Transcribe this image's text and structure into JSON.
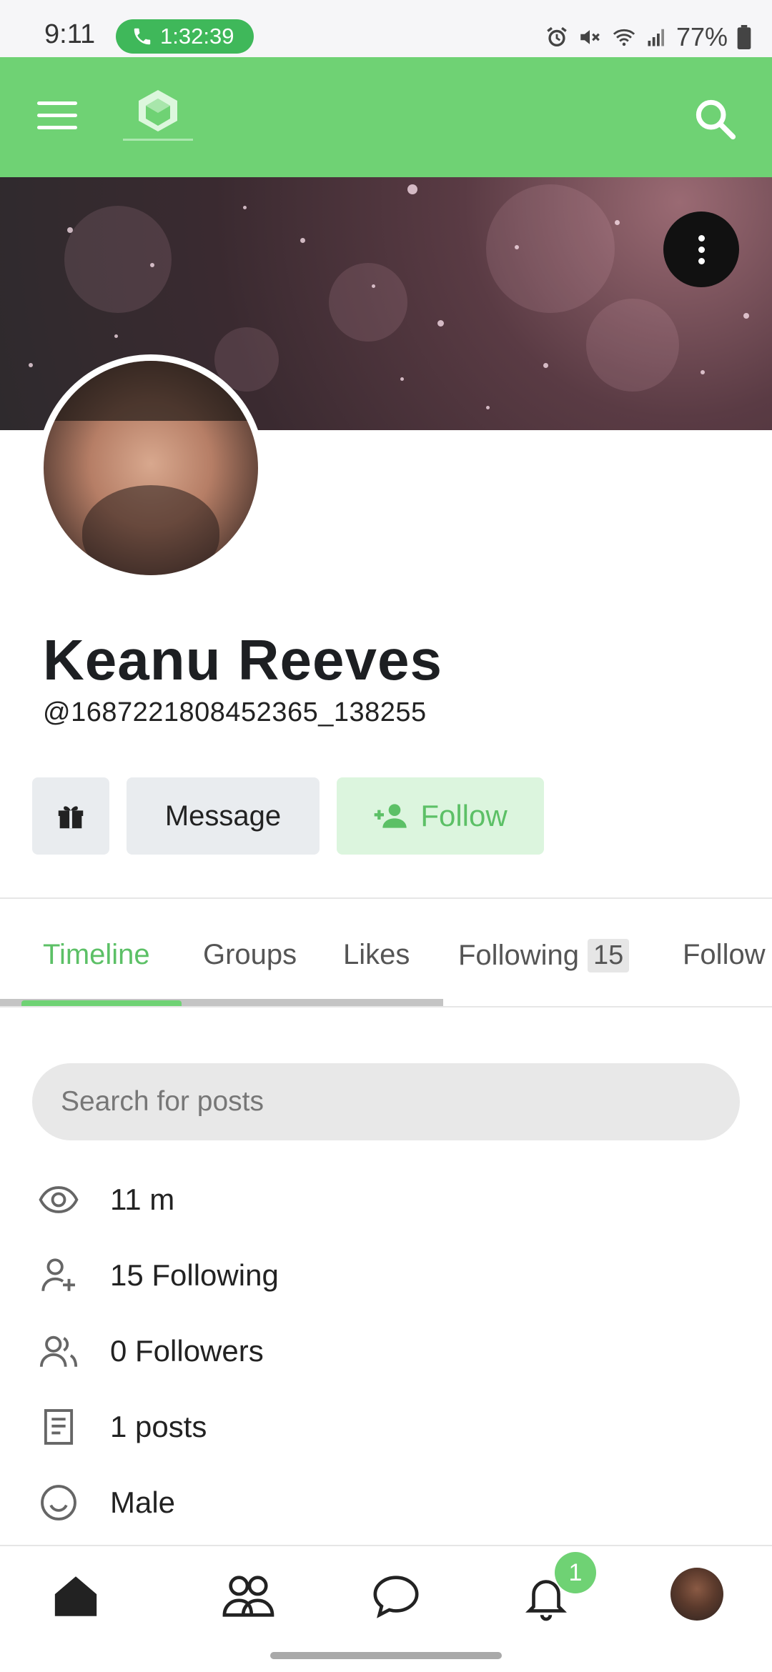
{
  "status_bar": {
    "time": "9:11",
    "call_duration": "1:32:39",
    "battery": "77%"
  },
  "app_bar": {
    "logo": "brand-logo"
  },
  "profile": {
    "name": "Keanu Reeves",
    "handle": "@1687221808452365_138255"
  },
  "actions": {
    "message_label": "Message",
    "follow_label": "Follow"
  },
  "tabs": [
    {
      "label": "Timeline",
      "active": true
    },
    {
      "label": "Groups"
    },
    {
      "label": "Likes"
    },
    {
      "label": "Following",
      "count": "15"
    },
    {
      "label": "Follow"
    }
  ],
  "search": {
    "placeholder": "Search for posts"
  },
  "info": {
    "joined": "11 m",
    "following": "15 Following",
    "followers": "0 Followers",
    "posts": "1 posts",
    "gender": "Male"
  },
  "bottom_nav": {
    "notification_count": "1"
  },
  "colors": {
    "accent": "#6fd274",
    "accent_text": "#5cc066",
    "follow_bg": "#dcf5de",
    "button_bg": "#e9ecef"
  }
}
